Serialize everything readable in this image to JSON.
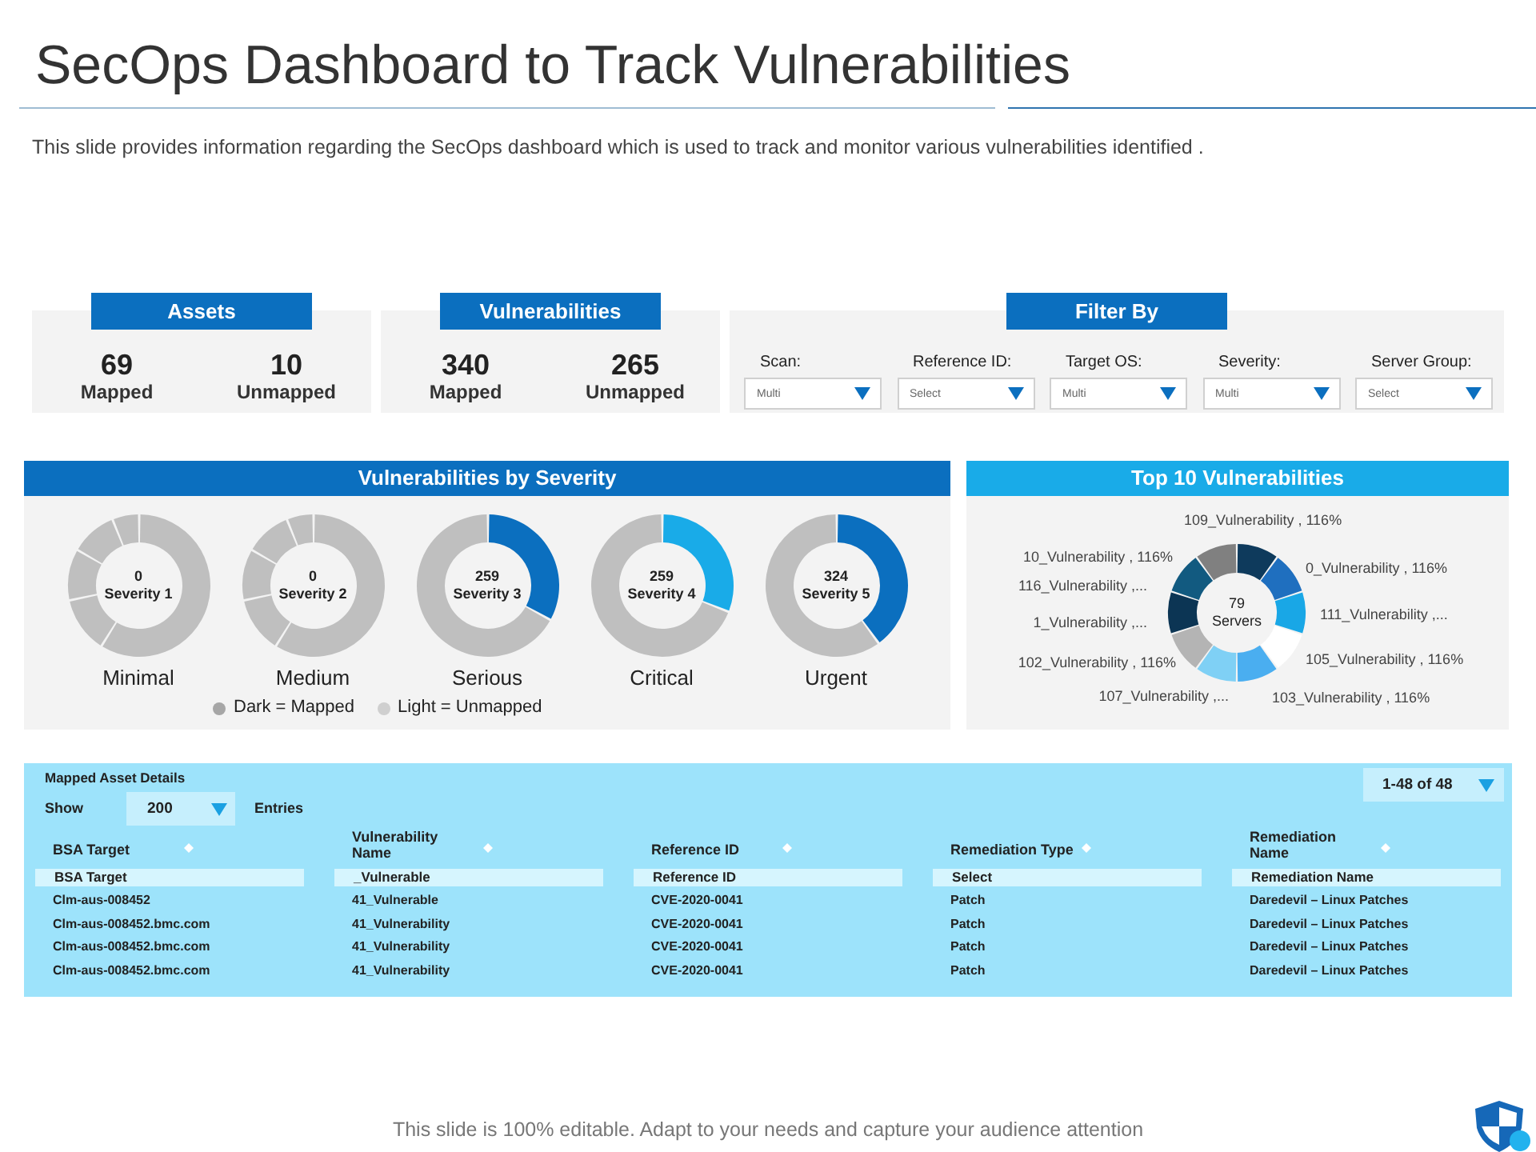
{
  "title": "SecOps Dashboard to Track Vulnerabilities",
  "subtitle": "This slide provides information regarding the SecOps dashboard which is used to track and monitor various vulnerabilities identified .",
  "summary_cards": [
    {
      "heading": "Assets",
      "stats": [
        {
          "value": "69",
          "label": "Mapped"
        },
        {
          "value": "10",
          "label": "Unmapped"
        }
      ]
    },
    {
      "heading": "Vulnerabilities",
      "stats": [
        {
          "value": "340",
          "label": "Mapped"
        },
        {
          "value": "265",
          "label": "Unmapped"
        }
      ]
    }
  ],
  "filter_panel": {
    "heading": "Filter By",
    "filters": [
      {
        "label": "Scan:",
        "value": "Multi"
      },
      {
        "label": "Reference ID:",
        "value": "Select"
      },
      {
        "label": "Target OS:",
        "value": "Multi"
      },
      {
        "label": "Severity:",
        "value": "Multi"
      },
      {
        "label": "Server Group:",
        "value": "Select"
      }
    ]
  },
  "severity_panel": {
    "heading": "Vulnerabilities by Severity",
    "donuts": [
      {
        "count": "0",
        "name": "Severity 1",
        "label": "Minimal"
      },
      {
        "count": "0",
        "name": "Severity 2",
        "label": "Medium"
      },
      {
        "count": "259",
        "name": "Severity 3",
        "label": "Serious",
        "color": "#0b6fbf"
      },
      {
        "count": "259",
        "name": "Severity 4",
        "label": "Critical",
        "color": "#19abe8"
      },
      {
        "count": "324",
        "name": "Severity 5",
        "label": "Urgent",
        "color": "#0b6fbf"
      }
    ],
    "legend": [
      {
        "label": "Dark = Mapped",
        "color": "#a6a6a6"
      },
      {
        "label": "Light = Unmapped",
        "color": "#cfcfcf"
      }
    ]
  },
  "top_panel": {
    "heading": "Top 10 Vulnerabilities",
    "center_value": "79",
    "center_label": "Servers",
    "slices": [
      {
        "label": "109_Vulnerability , 116%",
        "color": "#0e3a5c"
      },
      {
        "label": "10_Vulnerability , 116%",
        "color": "#808080"
      },
      {
        "label": "0_Vulnerability , 116%",
        "color": "#1f6fbf"
      },
      {
        "label": "116_Vulnerability ,...",
        "color": "#125a80"
      },
      {
        "label": "1_Vulnerability ,...",
        "color": "#0c3554"
      },
      {
        "label": "111_Vulnerability ,...",
        "color": "#19a7e6"
      },
      {
        "label": "102_Vulnerability , 116%",
        "color": "#b4b4b4"
      },
      {
        "label": "105_Vulnerability , 116%",
        "color": "#ffffff"
      },
      {
        "label": "107_Vulnerability ,...",
        "color": "#7fd0f5"
      },
      {
        "label": "103_Vulnerability , 116%",
        "color": "#4aaef0"
      }
    ]
  },
  "asset_table": {
    "title": "Mapped Asset Details",
    "show_label": "Show",
    "page_size": "200",
    "entries_label": "Entries",
    "pager": "1-48 of 48",
    "columns": [
      "BSA Target",
      "Vulnerability Name",
      "Reference ID",
      "Remediation Type",
      "Remediation Name"
    ],
    "filters": [
      "BSA Target",
      "_Vulnerable",
      "Reference ID",
      "Select",
      "Remediation Name"
    ],
    "rows": [
      [
        "Clm-aus-008452",
        "41_Vulnerable",
        "CVE-2020-0041",
        "Patch",
        "Daredevil – Linux Patches"
      ],
      [
        "Clm-aus-008452.bmc.com",
        "41_Vulnerability",
        "CVE-2020-0041",
        "Patch",
        "Daredevil – Linux Patches"
      ],
      [
        "Clm-aus-008452.bmc.com",
        "41_Vulnerability",
        "CVE-2020-0041",
        "Patch",
        "Daredevil – Linux Patches"
      ],
      [
        "Clm-aus-008452.bmc.com",
        "41_Vulnerability",
        "CVE-2020-0041",
        "Patch",
        "Daredevil – Linux Patches"
      ]
    ]
  },
  "footer": "This slide is 100% editable. Adapt to your needs and capture your audience attention"
}
